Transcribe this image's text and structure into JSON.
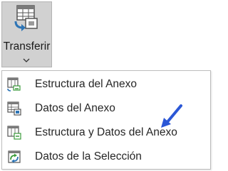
{
  "ribbon": {
    "transfer_button": {
      "label": "Transferir",
      "icon": "table-transfer-icon"
    }
  },
  "menu": {
    "items": [
      {
        "label": "Estructura del Anexo",
        "icon": "table-structure-icon"
      },
      {
        "label": "Datos del Anexo",
        "icon": "table-data-icon"
      },
      {
        "label": "Estructura y Datos del Anexo",
        "icon": "table-structure-data-icon"
      },
      {
        "label": "Datos de la Selección",
        "icon": "selection-data-icon"
      }
    ]
  },
  "colors": {
    "button_bg": "#d1d1d1",
    "icon_blue": "#2e75b6",
    "icon_green": "#3c9c3c",
    "icon_gray": "#555555",
    "arrow_blue": "#2b57d6"
  },
  "annotation": {
    "icon": "blue-arrow-pointer-icon"
  }
}
